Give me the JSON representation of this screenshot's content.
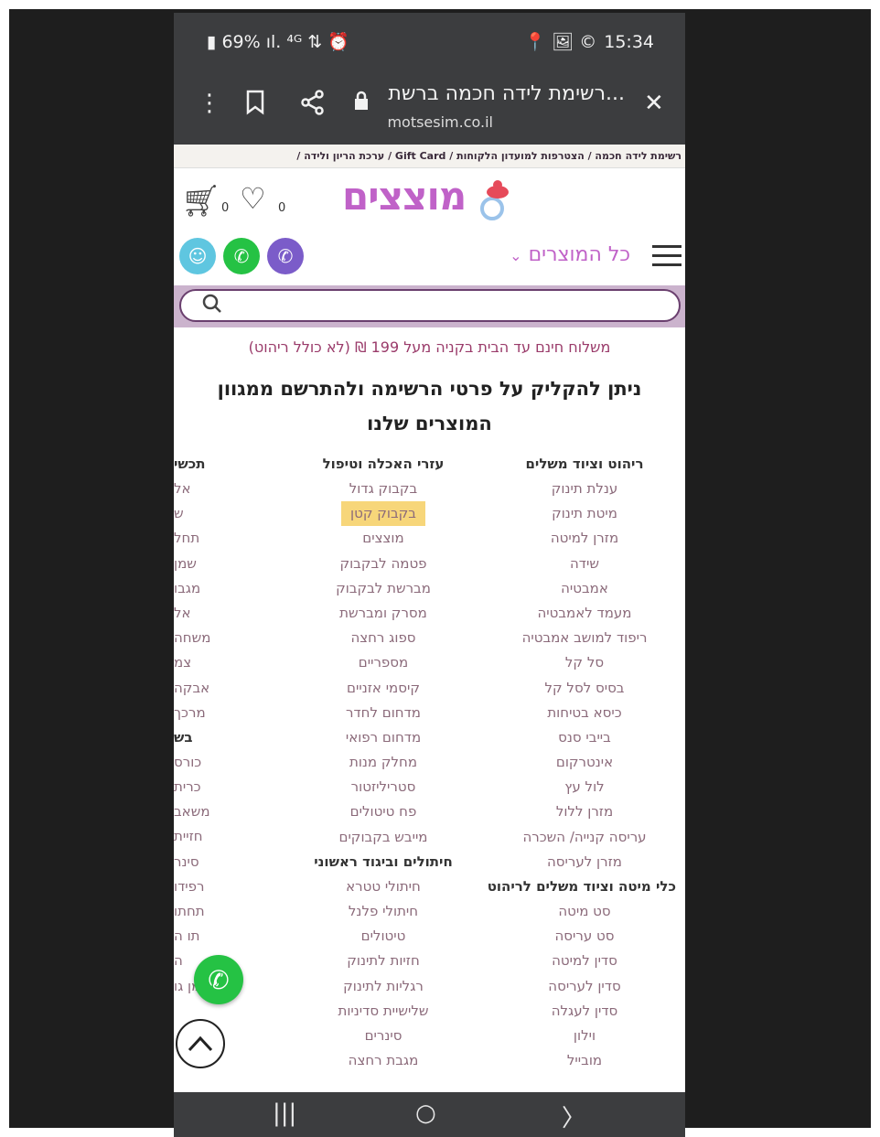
{
  "status_bar": {
    "battery": "69%",
    "signal_icons": "ıl. ⁴ᴳ ⇅ ⏰",
    "time": "15:34",
    "right_icons": "📍 🖼 ©"
  },
  "browser": {
    "page_title": "...רשימת לידה חכמה ברשת",
    "domain": "motsesim.co.il"
  },
  "breadcrumbs": "רשימת לידה חכמה / הצטרפות למועדון הלקוחות / Gift Card / ערכת הריון ולידה /",
  "header": {
    "logo_text": "מוצצים",
    "cart_count": "0",
    "wishlist_count": "0",
    "all_products": "כל המוצרים"
  },
  "search": {
    "placeholder": ""
  },
  "shipping_note": "משלוח חינם עד הבית בקניה מעל 199 ₪ (לא כולל ריהוט)",
  "headline": "ניתן להקליק על פרטי הרשימה ולהתרשם ממגוון המוצרים שלנו",
  "columns": [
    {
      "sections": [
        {
          "title": "ריהוט וציוד משלים",
          "items": [
            "ענלת תינוק",
            "מיטת תינוק",
            "מזרן למיטה",
            "שידה",
            "אמבטיה",
            "מעמד לאמבטיה",
            "ריפוד למושב אמבטיה",
            "סל קל",
            "בסיס לסל קל",
            "כיסא בטיחות",
            "בייבי סנס",
            "אינטרקום",
            "לול עץ",
            "מזרן ללול",
            "עריסה קנייה/ השכרה",
            "מזרן לעריסה"
          ]
        },
        {
          "title": "כלי מיטה וציוד משלים לריהוט",
          "items": [
            "סט מיטה",
            "סט עריסה",
            "סדין למיטה",
            "סדין לעריסה",
            "סדין לעגלה",
            "וילון",
            "מובייל"
          ]
        }
      ]
    },
    {
      "sections": [
        {
          "title": "עזרי האכלה וטיפול",
          "items": [
            "בקבוק גדול",
            "בקבוק קטן",
            "מוצצים",
            "פטמה לבקבוק",
            "מברשת לבקבוק",
            "מסרק ומברשת",
            "ספוג רחצה",
            "מספריים",
            "קיסמי אזניים",
            "מדחום לחדר",
            "מדחום רפואי",
            "מחלק מנות",
            "סטריליזטור",
            "פח טיטולים",
            "מייבש בקבוקים"
          ]
        },
        {
          "title": "חיתולים וביגוד ראשוני",
          "items": [
            "חיתולי טטרא",
            "חיתולי פלנל",
            "טיטולים",
            "חזיות לתינוק",
            "רגליות לתינוק",
            "שלישיית סדיניות",
            "סינרים",
            "מגבת רחצה"
          ]
        }
      ]
    },
    {
      "sections": [
        {
          "title": "תכשי",
          "items": [
            "אל",
            "ש",
            "תחל",
            "שמן",
            "מגבו",
            "אל",
            "משחה",
            "צמ",
            "אבקה",
            "מרכך"
          ]
        },
        {
          "title": "בש",
          "items": [
            "כורס",
            "כרית",
            "משאב",
            "חזיית",
            "סינר",
            "רפידו",
            "תחתו",
            "תו ה",
            "ה",
            "שמן גו",
            ""
          ]
        }
      ]
    }
  ],
  "highlighted_item": "בקבוק קטן",
  "bottom_nav": {
    "recent": "|||",
    "home": "○",
    "back": "〉"
  },
  "colors": {
    "brand_purple": "#c062c8",
    "status_bar": "#3c3d3f",
    "search_band": "#cbb3cd",
    "highlight": "#f7d67a",
    "whatsapp": "#25c244",
    "viber": "#7b5cc9",
    "waze": "#5fc6e0"
  }
}
